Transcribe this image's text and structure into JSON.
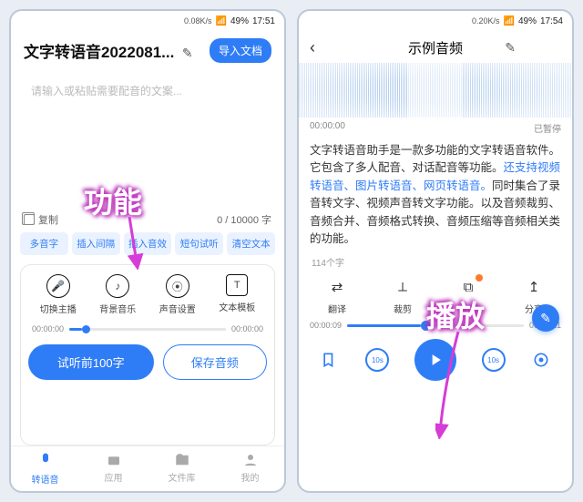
{
  "left": {
    "status": {
      "net": "0.08K/s",
      "batt": "49%",
      "time": "17:51"
    },
    "title": "文字转语音2022081...",
    "import_btn": "导入文档",
    "placeholder": "请输入或粘贴需要配音的文案...",
    "copy_label": "复制",
    "counter": "0 / 10000 字",
    "pills": [
      "多音字",
      "插入间隔",
      "插入音效",
      "短句试听",
      "清空文本"
    ],
    "icons": [
      {
        "name": "mic-icon",
        "label": "切换主播"
      },
      {
        "name": "music-icon",
        "label": "背景音乐"
      },
      {
        "name": "sound-icon",
        "label": "声音设置"
      },
      {
        "name": "template-icon",
        "label": "文本模板"
      }
    ],
    "time_start": "00:00:00",
    "time_end": "00:00:00",
    "btn_primary": "试听前100字",
    "btn_secondary": "保存音频",
    "tabs": [
      {
        "name": "tts-tab",
        "label": "转语音",
        "active": true
      },
      {
        "name": "apps-tab",
        "label": "应用"
      },
      {
        "name": "files-tab",
        "label": "文件库"
      },
      {
        "name": "me-tab",
        "label": "我的"
      }
    ],
    "annot": "功能"
  },
  "right": {
    "status": {
      "net": "0.20K/s",
      "batt": "49%",
      "time": "17:54"
    },
    "title": "示例音频",
    "wave_start": "00:00:00",
    "wave_status": "已暂停",
    "body_plain1": "文字转语音助手是一款多功能的文字转语音软件。它包含了多人配音、对话配音等功能。",
    "body_link": "还支持视频转语音、图片转语音、网页转语音。",
    "body_plain2": "同时集合了录音转文字、视频声音转文字功能。以及音频裁剪、音频合并、音频格式转换、音频压缩等音频相关类的功能。",
    "word_count": "114个字",
    "actions": [
      {
        "name": "translate-icon",
        "label": "翻译",
        "glyph": "⇄"
      },
      {
        "name": "crop-icon",
        "label": "裁剪",
        "glyph": "✂"
      },
      {
        "name": "copy-icon",
        "label": "复制",
        "glyph": "⧉",
        "badge": true
      },
      {
        "name": "share-icon",
        "label": "分享",
        "glyph": "↥"
      }
    ],
    "p_start": "00:00:09",
    "p_end": "00:00:21",
    "seek_back": "10s",
    "seek_fwd": "10s",
    "annot": "播放"
  }
}
